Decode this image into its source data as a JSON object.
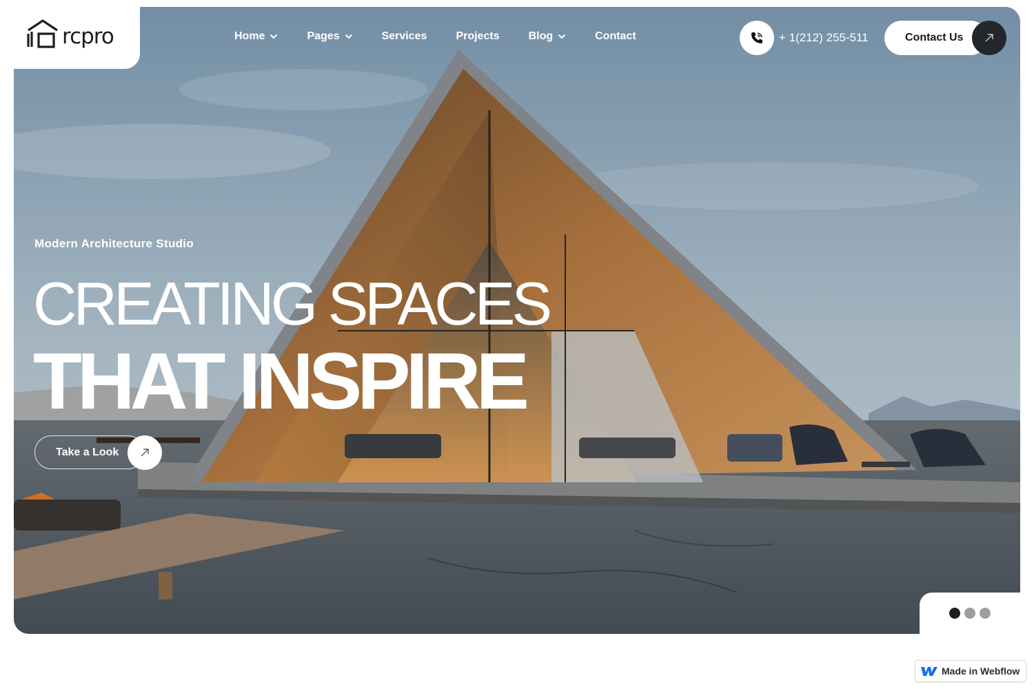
{
  "brand": {
    "logo_text": "rcpro"
  },
  "nav": {
    "items": [
      {
        "label": "Home",
        "has_dropdown": true
      },
      {
        "label": "Pages",
        "has_dropdown": true
      },
      {
        "label": "Services",
        "has_dropdown": false
      },
      {
        "label": "Projects",
        "has_dropdown": false
      },
      {
        "label": "Blog",
        "has_dropdown": true
      },
      {
        "label": "Contact",
        "has_dropdown": false
      }
    ]
  },
  "header": {
    "phone": "+ 1(212) 255-511",
    "contact_label": "Contact Us"
  },
  "hero": {
    "eyebrow": "Modern Architecture Studio",
    "headline_line1": "CREATING SPACES",
    "headline_line2": "THAT INSPIRE",
    "cta_label": "Take a Look"
  },
  "slider": {
    "count": 3,
    "active_index": 0
  },
  "badge": {
    "label": "Made in Webflow"
  },
  "colors": {
    "dark": "#23262b",
    "white": "#ffffff",
    "dot_inactive": "#9b9ea3"
  },
  "icons": [
    "logo-house-icon",
    "chevron-down-icon",
    "phone-icon",
    "arrow-up-right-icon",
    "webflow-icon"
  ]
}
